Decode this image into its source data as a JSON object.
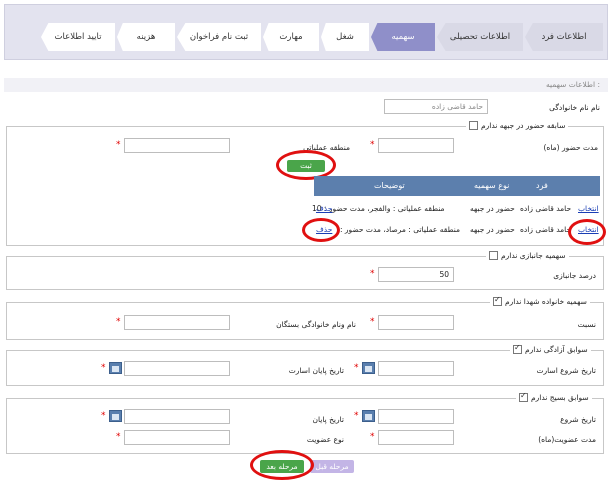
{
  "wizard": {
    "steps": [
      {
        "label": "اطلاعات فرد",
        "state": "done"
      },
      {
        "label": "اطلاعات تحصیلی",
        "state": "done"
      },
      {
        "label": "سهمیه",
        "state": "active"
      },
      {
        "label": "شغل",
        "state": "todo"
      },
      {
        "label": "مهارت",
        "state": "todo"
      },
      {
        "label": "ثبت نام فراخوان",
        "state": "todo"
      },
      {
        "label": "هزینه",
        "state": "todo"
      },
      {
        "label": "تایید اطلاعات",
        "state": "todo"
      }
    ]
  },
  "section": {
    "title": "اطلاعات سهمیه :"
  },
  "family_name": {
    "label": "نام نام خانوادگی",
    "value": "حامد قاضی زاده"
  },
  "front": {
    "legend": "سابقه حضور در جبهه ندارم",
    "checked": false,
    "duration_label": "مدت حضور (ماه)",
    "region_label": "منطقه عملیاتی",
    "add_button": "ثبت",
    "grid": {
      "headers": [
        "فرد",
        "نوع سهمیه",
        "توضیحات"
      ],
      "rows": [
        {
          "select": "انتخاب",
          "person": "حامد قاضی زاده",
          "type": "حضور در جبهه",
          "desc": "منطقه عملیاتی : والفجر، مدت حضور : 10",
          "delete": "حذف"
        },
        {
          "select": "انتخاب",
          "person": "حامد قاضی زاده",
          "type": "حضور در جبهه",
          "desc": "منطقه عملیاتی : مرصاد، مدت حضور :",
          "delete": "حذف"
        }
      ]
    }
  },
  "veteran": {
    "legend": "سهمیه جانبازی ندارم",
    "checked": false,
    "percent_label": "درصد جانبازی",
    "percent_value": "50"
  },
  "martyr": {
    "legend": "سهمیه خانواده شهدا ندارم",
    "checked": true,
    "relation_label": "نسبت",
    "name_label": "نام ونام خانوادگی بستگان"
  },
  "captivity": {
    "legend": "سوابق آزادگی ندارم",
    "checked": true,
    "start_label": "تاریخ شروع اسارت",
    "end_label": "تاریخ پایان اسارت"
  },
  "basij": {
    "legend": "سوابق بسیج ندارم",
    "checked": true,
    "start_label": "تاریخ شروع",
    "end_label": "تاریخ پایان",
    "duration_label": "مدت عضویت(ماه)",
    "type_label": "نوع عضویت"
  },
  "nav": {
    "next": "مرحله بعد",
    "prev": "مرحله قبل"
  },
  "colors": {
    "accent": "#8f8fc9",
    "grid_header": "#5c7fad",
    "green": "#4aa54a",
    "highlight": "#e01010"
  }
}
